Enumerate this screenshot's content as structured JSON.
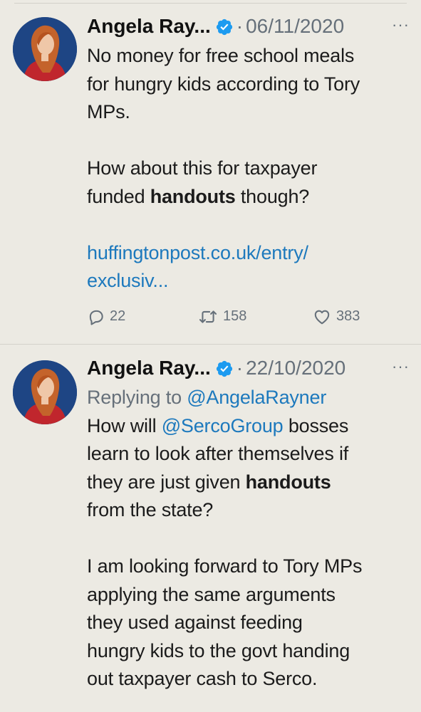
{
  "tweets": [
    {
      "author": "Angela Ray...",
      "separator": "·",
      "date": "06/11/2020",
      "more": "···",
      "lines": [
        [
          {
            "t": "No money for free school meals"
          }
        ],
        [
          {
            "t": "for hungry kids according to Tory"
          }
        ],
        [
          {
            "t": "MPs."
          }
        ],
        [],
        [
          {
            "t": "How about this for taxpayer"
          }
        ],
        [
          {
            "t": "funded "
          },
          {
            "t": "handouts",
            "b": true
          },
          {
            "t": " though?"
          }
        ],
        [],
        [
          {
            "t": "huffingtonpost.co.uk/entry/",
            "link": true
          }
        ],
        [
          {
            "t": "exclusiv...",
            "link": true
          }
        ]
      ],
      "stats": {
        "replies": "22",
        "retweets": "158",
        "likes": "383"
      }
    },
    {
      "author": "Angela Ray...",
      "separator": "·",
      "date": "22/10/2020",
      "more": "···",
      "lines": [
        [
          {
            "t": "Replying to ",
            "muted": true
          },
          {
            "t": "@AngelaRayner",
            "link": true
          }
        ],
        [
          {
            "t": "How will "
          },
          {
            "t": "@SercoGroup",
            "link": true
          },
          {
            "t": " bosses"
          }
        ],
        [
          {
            "t": "learn to look after themselves if"
          }
        ],
        [
          {
            "t": "they are just given "
          },
          {
            "t": "handouts",
            "b": true
          }
        ],
        [
          {
            "t": "from the state?"
          }
        ],
        [],
        [
          {
            "t": "I am looking forward to Tory MPs"
          }
        ],
        [
          {
            "t": "applying the same arguments"
          }
        ],
        [
          {
            "t": "they used against feeding"
          }
        ],
        [
          {
            "t": "hungry kids to the govt handing"
          }
        ],
        [
          {
            "t": "out taxpayer cash to Serco."
          }
        ]
      ]
    }
  ],
  "colors": {
    "background": "#eceae3",
    "link": "#1d79bd",
    "muted": "#66707a",
    "verified": "#1d9bf0"
  },
  "icons": {
    "verified": "verified-badge-icon",
    "reply": "reply-icon",
    "retweet": "retweet-icon",
    "like": "heart-icon",
    "more": "more-options-icon"
  }
}
